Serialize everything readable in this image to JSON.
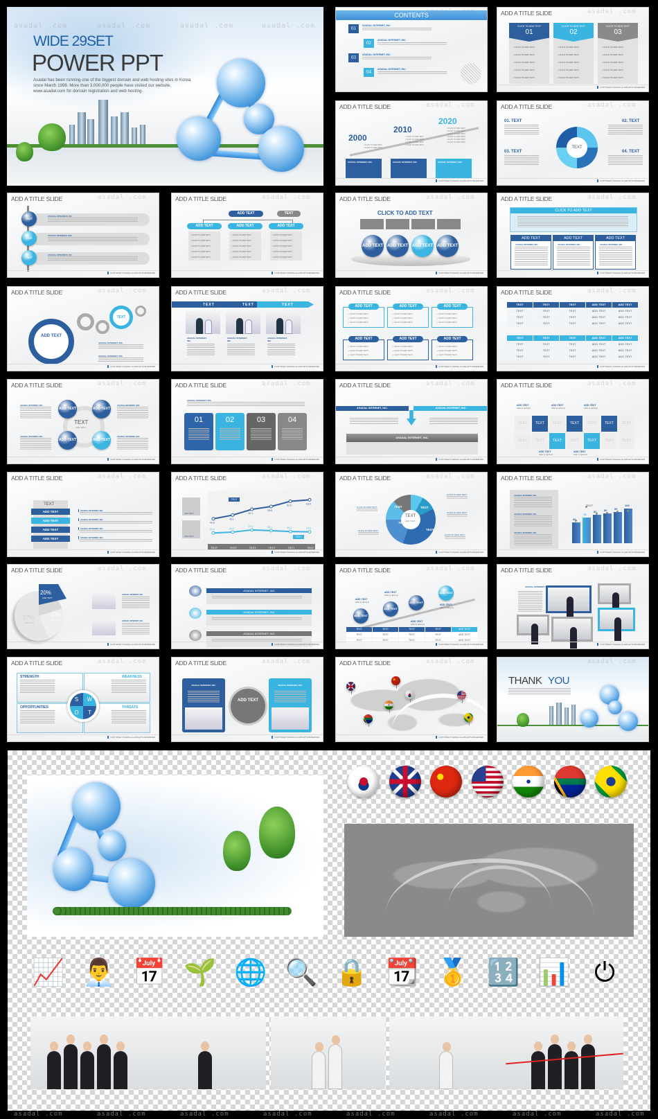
{
  "watermark": "asadal .com",
  "footer": "COPYRIGHT ASADAL ALLRIGHTS RESERVED",
  "hero": {
    "kicker": "WIDE 29SET",
    "title": "POWER PPT",
    "body": "Asadal has been running one of the biggest domain and web hosting sites in Korea since March 1998.  More than 3,000,000 people have visited our website, www.asadal.com for domain registration and web hosting."
  },
  "colors": {
    "dark_blue": "#2d5f9e",
    "light_blue": "#3ab4e0",
    "gray": "#8a8a8a",
    "background": "#000000"
  },
  "slides": [
    {
      "type": "contents",
      "header": "CONTENTS",
      "items": [
        {
          "num": "01",
          "heading": "ASADAL INTERNET, INC."
        },
        {
          "num": "02",
          "heading": "ASADAL INTERNET, INC."
        },
        {
          "num": "03",
          "heading": "ASADAL INTERNET, INC."
        },
        {
          "num": "04",
          "heading": "ASADAL INTERNET, INC."
        }
      ]
    },
    {
      "type": "tabs3",
      "title": "ADD A TITLE SLIDE",
      "tabs": [
        {
          "head": "CLICK TO ADD TEXT",
          "num": "01"
        },
        {
          "head": "CLICK TO ADD TEXT",
          "num": "02"
        },
        {
          "head": "CLICK TO ADD TEXT",
          "num": "03"
        }
      ],
      "bullet": "CLICK TO ADD TEXT"
    },
    {
      "type": "timeline",
      "title": "ADD A TITLE SLIDE",
      "years": [
        "2000",
        "2010",
        "2020"
      ],
      "bullet": "CLICK TO ADD TEXT",
      "box_heading": "ASADAL INTERNET, INC."
    },
    {
      "type": "cycle4",
      "title": "ADD A TITLE SLIDE",
      "labels": [
        "01. TEXT",
        "02. TEXT",
        "03. TEXT",
        "04. TEXT"
      ],
      "center": "TEXT",
      "segment": "TEXT"
    },
    {
      "type": "vlist",
      "title": "ADD A TITLE SLIDE",
      "circle": "TEXT",
      "heading": "ASADAL INTERNET, INC."
    },
    {
      "type": "org",
      "title": "ADD A TITLE SLIDE",
      "top": "ADD TEXT",
      "side": "TEXT",
      "child": "ADD TEXT",
      "bullet": "CLICK TO ADD TEXT"
    },
    {
      "type": "spheres",
      "title": "ADD A TITLE SLIDE",
      "heading": "CLICK TO ADD TEXT",
      "sphere": "ADD TEXT"
    },
    {
      "type": "boxed",
      "title": "ADD A TITLE SLIDE",
      "header": "CLICK TO ADD TEXT",
      "column": "ADD TEXT",
      "column_heading": "ASADAL INTERNET, INC."
    },
    {
      "type": "rings",
      "title": "ADD A TITLE SLIDE",
      "big": "ADD TEXT",
      "small": "TEXT",
      "heading": "ASADAL INTERNET, INC."
    },
    {
      "type": "arrowphotos",
      "title": "ADD A TITLE SLIDE",
      "steps": [
        "TEXT",
        "TEXT",
        "TEXT"
      ],
      "heading": "ASADAL INTERNET, INC."
    },
    {
      "type": "sixbox",
      "title": "ADD A TITLE SLIDE",
      "box": "ADD TEXT",
      "bullet": "CLICK TO ADD TEXT"
    },
    {
      "type": "table",
      "title": "ADD A TITLE SLIDE",
      "headers": [
        "TEXT",
        "TEXT",
        "TEXT",
        "ADD TEXT",
        "ADD TEXT"
      ],
      "rows": [
        [
          "TEXT",
          "TEXT",
          "TEXT",
          "ADD TEXT",
          "ADD TEXT"
        ],
        [
          "TEXT",
          "TEXT",
          "TEXT",
          "ADD TEXT",
          "ADD TEXT"
        ],
        [
          "TEXT",
          "TEXT",
          "TEXT",
          "ADD TEXT",
          "ADD TEXT"
        ]
      ]
    },
    {
      "type": "circles4",
      "title": "ADD A TITLE SLIDE",
      "ball": "ADD TEXT",
      "center": "TEXT",
      "center_sub": "ADD TEXT",
      "heading": "ASADAL INTERNET, INC."
    },
    {
      "type": "cards",
      "title": "ADD A TITLE SLIDE",
      "heading": "ASADAL INTERNET, INC.",
      "nums": [
        "01",
        "02",
        "03",
        "04"
      ]
    },
    {
      "type": "merge",
      "title": "ADD A TITLE SLIDE",
      "left": "ASADAL INTERNET, INC.",
      "right": "ASADAL INTERNET, INC.",
      "bottom": "ASADAL INTERNET, INC."
    },
    {
      "type": "grid",
      "title": "ADD A TITLE SLIDE",
      "cell": "TEXT",
      "callout": "ADD TEXT",
      "callout_sub": "Click to add text"
    },
    {
      "type": "stack",
      "title": "ADD A TITLE SLIDE",
      "top": "TEXT",
      "items": [
        "ADD TEXT",
        "ADD TEXT",
        "ADD TEXT",
        "ADD TEXT"
      ],
      "heading": "ASADAL INTERNET, INC."
    },
    {
      "type": "linechart",
      "title": "ADD A TITLE SLIDE",
      "categories": [
        "TEXT",
        "TEXT",
        "TEXT",
        "TEXT",
        "TEXT",
        "TEXT"
      ],
      "series": [
        {
          "values": [
            40.6,
            45.1,
            52.1,
            55.6,
            62.0,
            63.8
          ]
        },
        {
          "values": [
            23.3,
            24.3,
            27.0,
            26.1,
            25.0,
            24.6
          ]
        }
      ],
      "callout": "TEXT",
      "icon_label": "ADD TEXT"
    },
    {
      "type": "donut",
      "title": "ADD A TITLE SLIDE",
      "center": "TEXT",
      "center_sub": "ADD TEXT",
      "segment": "TEXT",
      "label": "CLICK TO ADD TEXT"
    },
    {
      "type": "bars",
      "title": "ADD A TITLE SLIDE",
      "values": [
        60,
        75,
        82,
        86,
        90,
        100
      ],
      "line_label": "TEXT",
      "heading": "ASADAL INTERNET, INC."
    },
    {
      "type": "pie",
      "title": "ADD A TITLE SLIDE",
      "slices": [
        {
          "pct": "20%",
          "label": "ADD TEXT"
        },
        {
          "pct": "57%",
          "label": "ADD TEXT"
        },
        {
          "pct": "23%",
          "label": "ADD TEXT"
        }
      ],
      "heading": "ASADAL INTERNET, INC."
    },
    {
      "type": "threebars",
      "title": "ADD A TITLE SLIDE",
      "bar": "ASADAL INTERNET, INC"
    },
    {
      "type": "steps",
      "title": "ADD A TITLE SLIDE",
      "ball": "ADD TEXT",
      "caption": "ADD TEXT",
      "caption_sub": "Click to add text",
      "headers": [
        "TEXT",
        "TEXT",
        "TEXT",
        "TEXT",
        "ADD TEXT"
      ],
      "rows": [
        [
          "TEXT",
          "TEXT",
          "TEXT",
          "TEXT",
          "ADD TEXT"
        ],
        [
          "TEXT",
          "TEXT",
          "TEXT",
          "TEXT",
          "ADD TEXT"
        ]
      ]
    },
    {
      "type": "collage",
      "title": "ADD A TITLE SLIDE",
      "heading": "ASADAL INTERNET, INC."
    },
    {
      "type": "swot",
      "title": "ADD A TITLE SLIDE",
      "quadrants": [
        "STRENGTH",
        "WEAKNESS",
        "OPPORTUNITIES",
        "THREATS"
      ],
      "letters": [
        "S",
        "W",
        "O",
        "T"
      ]
    },
    {
      "type": "twopanel",
      "title": "ADD A TITLE SLIDE",
      "center": "ADD TEXT",
      "heading": "ASADAL INTERNET, INC."
    },
    {
      "type": "map",
      "title": "ADD A TITLE SLIDE",
      "flags": [
        "uk",
        "china",
        "korea",
        "usa",
        "india",
        "south-africa",
        "brazil"
      ]
    },
    {
      "type": "thankyou",
      "title_dark": "THANK",
      "title_blue": "YOU"
    }
  ],
  "assets": {
    "flags": [
      "korea",
      "uk",
      "china",
      "usa",
      "india",
      "south-africa",
      "brazil"
    ],
    "icons": [
      "growth-chart-icon",
      "businessman-icon",
      "calendar-icon",
      "plant-icon",
      "globe-refresh-icon",
      "magnifier-book-icon",
      "lock-person-icon",
      "calendar-person-icon",
      "no1-person-icon",
      "blocks-123-icon",
      "bar-report-icon",
      "power-button-icon"
    ],
    "icon_glyphs": [
      "📈",
      "👨‍💼",
      "📅",
      "🌱",
      "🌐",
      "🔍",
      "🔒",
      "📆",
      "🥇",
      "🔢",
      "📊",
      "⏻"
    ],
    "photos": [
      "team-photo",
      "call-center-photo",
      "globe-discussion-photo",
      "desk-worker-photo",
      "finish-line-photo"
    ]
  }
}
